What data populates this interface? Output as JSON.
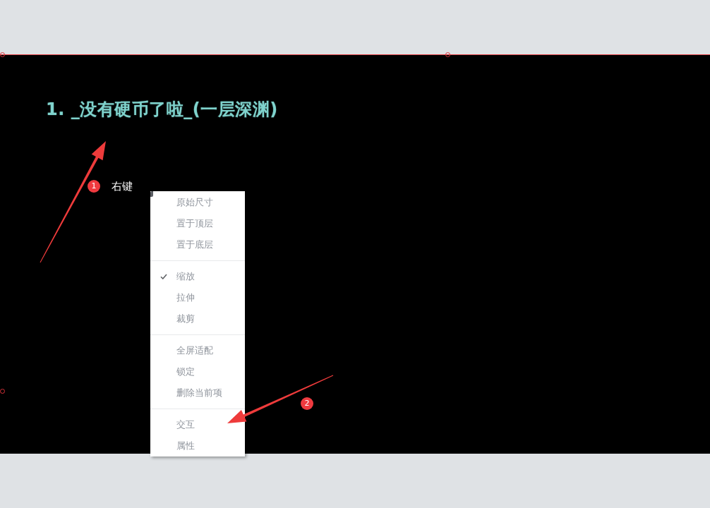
{
  "canvas": {
    "title": "1. _没有硬币了啦_(一层深渊)",
    "selected": true
  },
  "annotations": [
    {
      "number": "1",
      "label": "右键"
    },
    {
      "number": "2"
    }
  ],
  "context_menu": {
    "groups": [
      {
        "items": [
          {
            "label": "原始尺寸",
            "checked": false
          },
          {
            "label": "置于顶层",
            "checked": false
          },
          {
            "label": "置于底层",
            "checked": false
          }
        ]
      },
      {
        "items": [
          {
            "label": "缩放",
            "checked": true
          },
          {
            "label": "拉伸",
            "checked": false
          },
          {
            "label": "裁剪",
            "checked": false
          }
        ]
      },
      {
        "items": [
          {
            "label": "全屏适配",
            "checked": false
          },
          {
            "label": "锁定",
            "checked": false
          },
          {
            "label": "删除当前项",
            "checked": false
          }
        ]
      },
      {
        "items": [
          {
            "label": "交互",
            "checked": false
          },
          {
            "label": "属性",
            "checked": false
          }
        ]
      }
    ]
  }
}
